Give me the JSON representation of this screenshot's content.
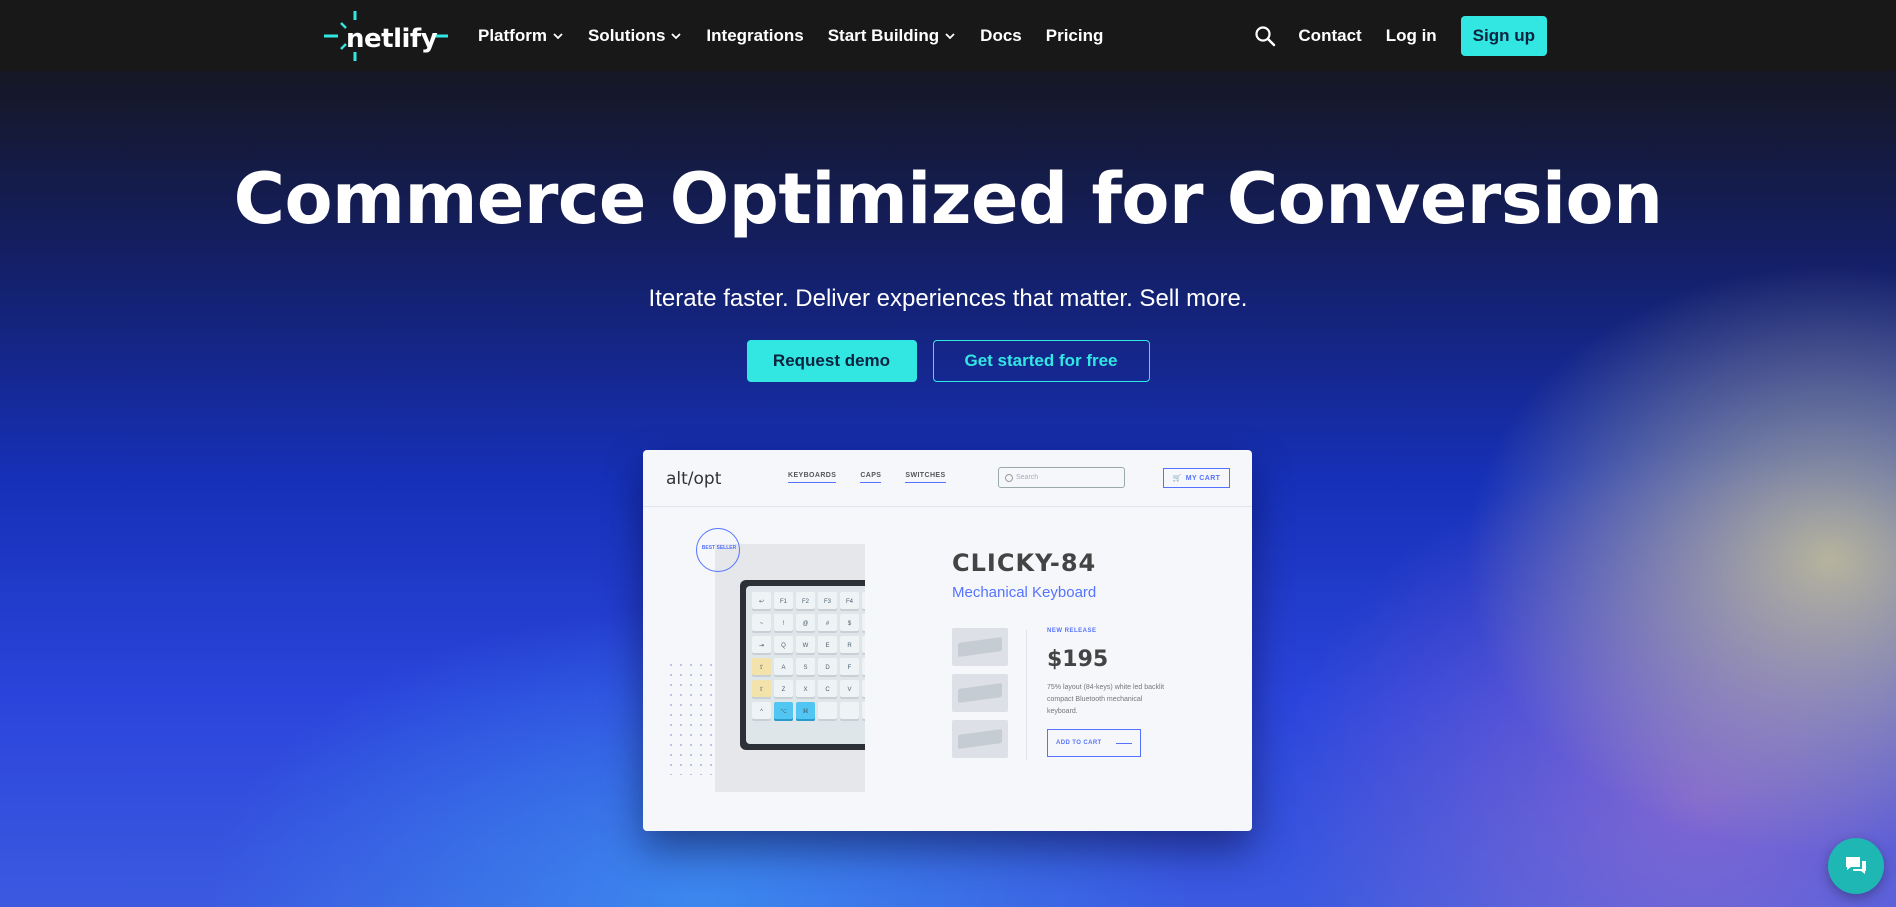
{
  "nav": {
    "logo_text": "netlify",
    "menu": [
      {
        "label": "Platform",
        "has_dropdown": true
      },
      {
        "label": "Solutions",
        "has_dropdown": true
      },
      {
        "label": "Integrations",
        "has_dropdown": false
      },
      {
        "label": "Start Building",
        "has_dropdown": true
      },
      {
        "label": "Docs",
        "has_dropdown": false
      },
      {
        "label": "Pricing",
        "has_dropdown": false
      }
    ],
    "contact_label": "Contact",
    "login_label": "Log in",
    "signup_label": "Sign up",
    "search_icon": "search-icon"
  },
  "hero": {
    "title": "Commerce Optimized for Conversion",
    "subtitle": "Iterate faster. Deliver experiences that matter. Sell more.",
    "primary_cta": "Request demo",
    "secondary_cta": "Get started for free"
  },
  "mockup": {
    "brand": "alt/opt",
    "nav": [
      "KEYBOARDS",
      "CAPS",
      "SWITCHES"
    ],
    "search_placeholder": "Search",
    "cart_label": "MY CART",
    "badge_text": "BEST SELLER",
    "product_title": "CLICKY-84",
    "product_subtitle": "Mechanical Keyboard",
    "release_tag": "NEW RELEASE",
    "price": "$195",
    "description": "75% layout (84-keys) white led backlit compact Bluetooth mechanical keyboard.",
    "add_to_cart": "ADD TO CART"
  },
  "colors": {
    "accent": "#32e6e2",
    "nav_bg": "#181818",
    "mock_accent": "#5573ff",
    "chat_bg": "#1fb7b3"
  }
}
